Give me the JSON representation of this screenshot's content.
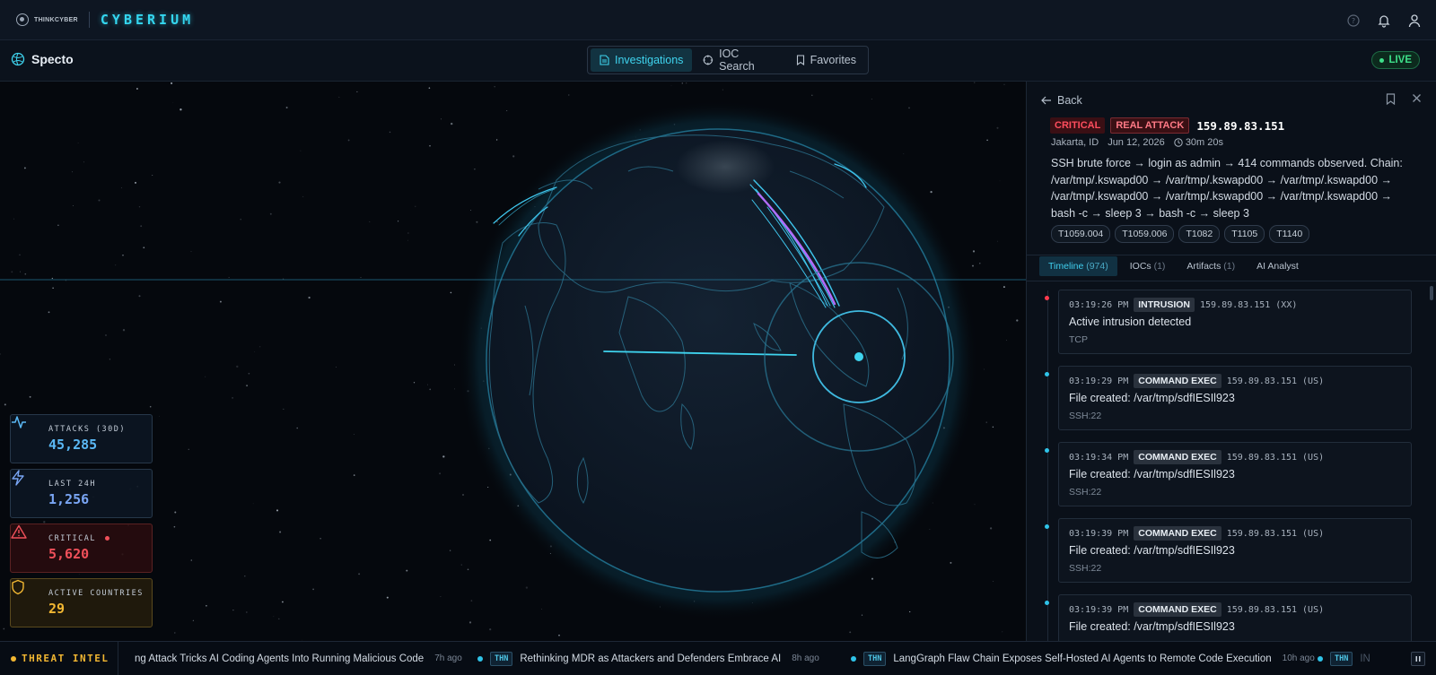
{
  "topbar": {
    "brand_small": "THINKCYBER",
    "brand_big": "CYBERIUM",
    "icons": [
      "help-icon",
      "bell-icon",
      "user-icon"
    ]
  },
  "subbar": {
    "app_title": "Specto",
    "tabs": [
      {
        "label": "Investigations",
        "icon": "document-icon",
        "active": true
      },
      {
        "label": "IOC Search",
        "icon": "crosshair-icon",
        "active": false
      },
      {
        "label": "Favorites",
        "icon": "bookmark-icon",
        "active": false
      }
    ],
    "live_label": "LIVE"
  },
  "stats": [
    {
      "label": "ATTACKS (30D)",
      "value": "45,285",
      "icon": "activity-icon",
      "color": "#5ab8f5"
    },
    {
      "label": "LAST 24H",
      "value": "1,256",
      "icon": "lightning-icon",
      "color": "#7aa6f5"
    },
    {
      "label": "CRITICAL",
      "value": "5,620",
      "icon": "warning-icon",
      "color": "#f0505a"
    },
    {
      "label": "ACTIVE COUNTRIES",
      "value": "29",
      "icon": "shield-icon",
      "color": "#f2b732"
    }
  ],
  "panel": {
    "back_label": "Back",
    "severity": "CRITICAL",
    "classification": "REAL ATTACK",
    "ip": "159.89.83.151",
    "location": "Jakarta, ID",
    "date": "Jun 12, 2026",
    "duration": "30m 20s",
    "description": "SSH brute force → login as admin → 414 commands observed. Chain: /var/tmp/.kswapd00 → /var/tmp/.kswapd00 → /var/tmp/.kswapd00 → /var/tmp/.kswapd00 → /var/tmp/.kswapd00 → /var/tmp/.kswapd00 → bash -c → sleep 3 → bash -c → sleep 3",
    "techniques": [
      "T1059.004",
      "T1059.006",
      "T1082",
      "T1105",
      "T1140"
    ],
    "tabs": [
      {
        "label": "Timeline",
        "count": "(974)",
        "active": true
      },
      {
        "label": "IOCs",
        "count": "(1)",
        "active": false
      },
      {
        "label": "Artifacts",
        "count": "(1)",
        "active": false
      },
      {
        "label": "AI Analyst",
        "count": "",
        "active": false
      }
    ],
    "events": [
      {
        "time": "03:19:26 PM",
        "type": "INTRUSION",
        "src": "159.89.83.151 (XX)",
        "title": "Active intrusion detected",
        "sub": "TCP",
        "dot": "red"
      },
      {
        "time": "03:19:29 PM",
        "type": "COMMAND EXEC",
        "src": "159.89.83.151 (US)",
        "title": "File created: /var/tmp/sdfIESIl923",
        "sub": "SSH:22",
        "dot": "cyan"
      },
      {
        "time": "03:19:34 PM",
        "type": "COMMAND EXEC",
        "src": "159.89.83.151 (US)",
        "title": "File created: /var/tmp/sdfIESIl923",
        "sub": "SSH:22",
        "dot": "cyan"
      },
      {
        "time": "03:19:39 PM",
        "type": "COMMAND EXEC",
        "src": "159.89.83.151 (US)",
        "title": "File created: /var/tmp/sdfIESIl923",
        "sub": "SSH:22",
        "dot": "cyan"
      },
      {
        "time": "03:19:39 PM",
        "type": "COMMAND EXEC",
        "src": "159.89.83.151 (US)",
        "title": "File created: /var/tmp/sdfIESIl923",
        "sub": "",
        "dot": "cyan"
      }
    ]
  },
  "ticker": {
    "label": "THREAT INTEL",
    "items": [
      {
        "src": "",
        "title": "ng Attack Tricks AI Coding Agents Into Running Malicious Code",
        "ago": "7h ago"
      },
      {
        "src": "THN",
        "title": "Rethinking MDR as Attackers and Defenders Embrace AI",
        "ago": "8h ago"
      },
      {
        "src": "THN",
        "title": "LangGraph Flaw Chain Exposes Self-Hosted AI Agents to Remote Code Execution",
        "ago": "10h ago"
      },
      {
        "src": "THN",
        "title": "IN",
        "ago": ""
      }
    ]
  }
}
